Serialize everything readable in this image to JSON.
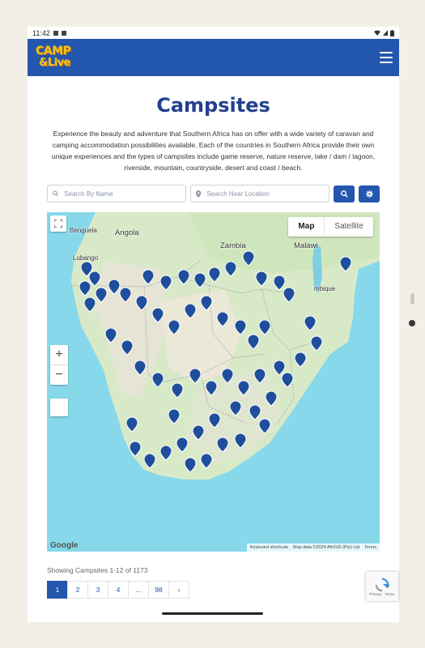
{
  "status": {
    "time": "11:42"
  },
  "brand": {
    "line1": "CAMP",
    "line2": "&Live"
  },
  "page": {
    "title": "Campsites",
    "intro": "Experience the beauty and adventure that Southern Africa has on offer with a wide variety of caravan and camping accommodation possibilities available. Each of the countries in Southern Africa provide their own unique experiences and the types of campsites include game reserve, nature reserve, lake / dam / lagoon, riverside, mountain, countryside, desert and coast / beach."
  },
  "search": {
    "name_placeholder": "Search By Name",
    "location_placeholder": "Search Near Location"
  },
  "map": {
    "map_label": "Map",
    "satellite_label": "Satellite",
    "zoom_in": "+",
    "zoom_out": "−",
    "google": "Google",
    "attrib_shortcuts": "Keyboard shortcuts",
    "attrib_data": "Map data ©2024 AfriGIS (Pty) Ltd",
    "attrib_terms": "Terms",
    "labels": {
      "bengula": "Benguela",
      "angola": "Angola",
      "zambia": "Zambia",
      "malawi": "Malawi",
      "lubango": "Lubango",
      "mozambique": "mbique"
    }
  },
  "results": {
    "showing": "Showing Campsites 1-12 of 1173",
    "pages": [
      "1",
      "2",
      "3",
      "4",
      "...",
      "98",
      "›"
    ]
  },
  "captcha": {
    "text": "Privacy - Terms"
  }
}
